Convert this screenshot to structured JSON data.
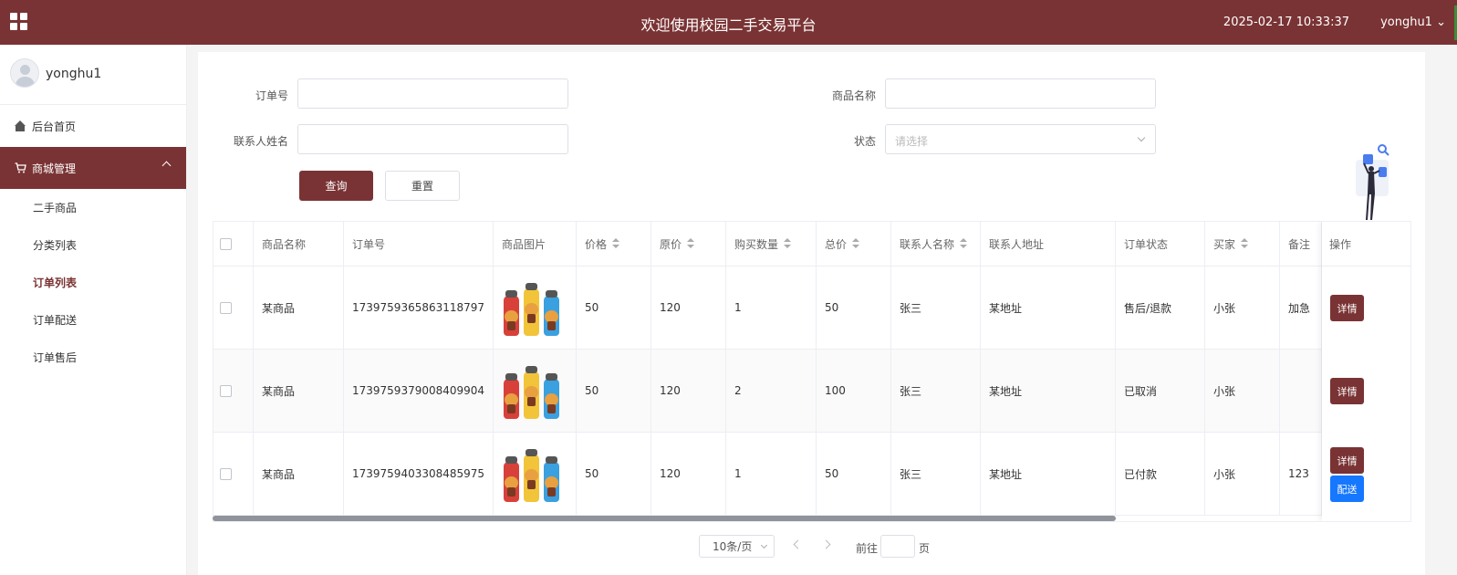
{
  "header": {
    "title": "欢迎使用校园二手交易平台",
    "datetime": "2025-02-17 10:33:37",
    "user": "yonghu1",
    "user_chevron": "⌄"
  },
  "sidebar": {
    "username": "yonghu1",
    "home": "后台首页",
    "mall": "商城管理",
    "sub_items": [
      "二手商品",
      "分类列表",
      "订单列表",
      "订单配送",
      "订单售后"
    ],
    "active_index": 2
  },
  "search": {
    "order_no_label": "订单号",
    "product_name_label": "商品名称",
    "contact_name_label": "联系人姓名",
    "status_label": "状态",
    "status_placeholder": "请选择",
    "query_button": "查询",
    "reset_button": "重置"
  },
  "table": {
    "headers": [
      "商品名称",
      "订单号",
      "商品图片",
      "价格",
      "原价",
      "购买数量",
      "总价",
      "联系人名称",
      "联系人地址",
      "订单状态",
      "买家",
      "备注",
      "操作"
    ],
    "rows": [
      {
        "name": "某商品",
        "order_no": "1739759365863118797",
        "price": "50",
        "orig_price": "120",
        "qty": "1",
        "total": "50",
        "contact": "张三",
        "address": "某地址",
        "status": "售后/退款",
        "buyer": "小张",
        "note": "加急"
      },
      {
        "name": "某商品",
        "order_no": "1739759379008409904",
        "price": "50",
        "orig_price": "120",
        "qty": "2",
        "total": "100",
        "contact": "张三",
        "address": "某地址",
        "status": "已取消",
        "buyer": "小张",
        "note": ""
      },
      {
        "name": "某商品",
        "order_no": "1739759403308485975",
        "price": "50",
        "orig_price": "120",
        "qty": "1",
        "total": "50",
        "contact": "张三",
        "address": "某地址",
        "status": "已付款",
        "buyer": "小张",
        "note": "123"
      }
    ],
    "detail_button": "详情",
    "blue_button": "配送"
  },
  "pagination": {
    "page_size": "10条/页",
    "goto_prefix": "前往",
    "goto_suffix": "页"
  },
  "colors": {
    "brand": "#7a3334",
    "accent_blue": "#1677ff"
  }
}
